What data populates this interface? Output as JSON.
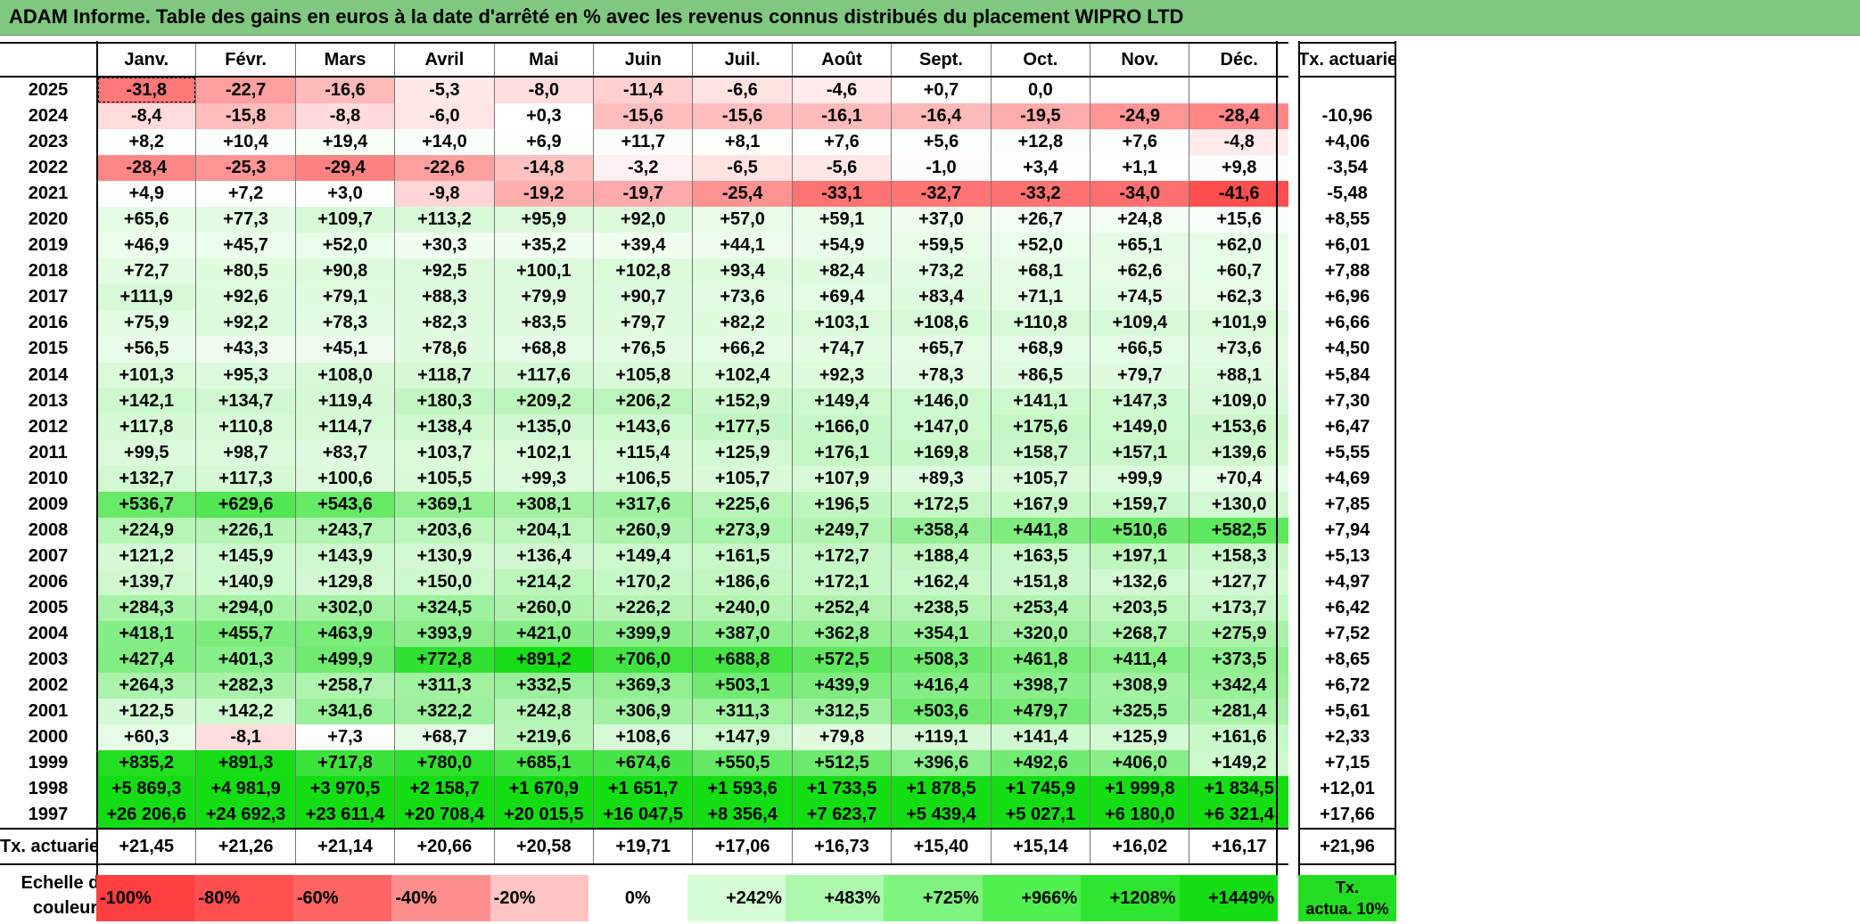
{
  "title": "ADAM Informe. Table des gains en euros à la date d'arrêté en % avec les revenus connus distribués du placement WIPRO LTD",
  "months": [
    "Janv.",
    "Févr.",
    "Mars",
    "Avril",
    "Mai",
    "Juin",
    "Juil.",
    "Août",
    "Sept.",
    "Oct.",
    "Nov.",
    "Déc."
  ],
  "side_header": "Tx. actuariel",
  "rows": [
    {
      "year": "2025",
      "values": [
        "-31,8",
        "-22,7",
        "-16,6",
        "-5,3",
        "-8,0",
        "-11,4",
        "-6,6",
        "-4,6",
        "+0,7",
        "0,0",
        "",
        ""
      ],
      "rate": ""
    },
    {
      "year": "2024",
      "values": [
        "-8,4",
        "-15,8",
        "-8,8",
        "-6,0",
        "+0,3",
        "-15,6",
        "-15,6",
        "-16,1",
        "-16,4",
        "-19,5",
        "-24,9",
        "-28,4"
      ],
      "rate": "-10,96"
    },
    {
      "year": "2023",
      "values": [
        "+8,2",
        "+10,4",
        "+19,4",
        "+14,0",
        "+6,9",
        "+11,7",
        "+8,1",
        "+7,6",
        "+5,6",
        "+12,8",
        "+7,6",
        "-4,8"
      ],
      "rate": "+4,06"
    },
    {
      "year": "2022",
      "values": [
        "-28,4",
        "-25,3",
        "-29,4",
        "-22,6",
        "-14,8",
        "-3,2",
        "-6,5",
        "-5,6",
        "-1,0",
        "+3,4",
        "+1,1",
        "+9,8"
      ],
      "rate": "-3,54"
    },
    {
      "year": "2021",
      "values": [
        "+4,9",
        "+7,2",
        "+3,0",
        "-9,8",
        "-19,2",
        "-19,7",
        "-25,4",
        "-33,1",
        "-32,7",
        "-33,2",
        "-34,0",
        "-41,6"
      ],
      "rate": "-5,48"
    },
    {
      "year": "2020",
      "values": [
        "+65,6",
        "+77,3",
        "+109,7",
        "+113,2",
        "+95,9",
        "+92,0",
        "+57,0",
        "+59,1",
        "+37,0",
        "+26,7",
        "+24,8",
        "+15,6"
      ],
      "rate": "+8,55"
    },
    {
      "year": "2019",
      "values": [
        "+46,9",
        "+45,7",
        "+52,0",
        "+30,3",
        "+35,2",
        "+39,4",
        "+44,1",
        "+54,9",
        "+59,5",
        "+52,0",
        "+65,1",
        "+62,0"
      ],
      "rate": "+6,01"
    },
    {
      "year": "2018",
      "values": [
        "+72,7",
        "+80,5",
        "+90,8",
        "+92,5",
        "+100,1",
        "+102,8",
        "+93,4",
        "+82,4",
        "+73,2",
        "+68,1",
        "+62,6",
        "+60,7"
      ],
      "rate": "+7,88"
    },
    {
      "year": "2017",
      "values": [
        "+111,9",
        "+92,6",
        "+79,1",
        "+88,3",
        "+79,9",
        "+90,7",
        "+73,6",
        "+69,4",
        "+83,4",
        "+71,1",
        "+74,5",
        "+62,3"
      ],
      "rate": "+6,96"
    },
    {
      "year": "2016",
      "values": [
        "+75,9",
        "+92,2",
        "+78,3",
        "+82,3",
        "+83,5",
        "+79,7",
        "+82,2",
        "+103,1",
        "+108,6",
        "+110,8",
        "+109,4",
        "+101,9"
      ],
      "rate": "+6,66"
    },
    {
      "year": "2015",
      "values": [
        "+56,5",
        "+43,3",
        "+45,1",
        "+78,6",
        "+68,8",
        "+76,5",
        "+66,2",
        "+74,7",
        "+65,7",
        "+68,9",
        "+66,5",
        "+73,6"
      ],
      "rate": "+4,50"
    },
    {
      "year": "2014",
      "values": [
        "+101,3",
        "+95,3",
        "+108,0",
        "+118,7",
        "+117,6",
        "+105,8",
        "+102,4",
        "+92,3",
        "+78,3",
        "+86,5",
        "+79,7",
        "+88,1"
      ],
      "rate": "+5,84"
    },
    {
      "year": "2013",
      "values": [
        "+142,1",
        "+134,7",
        "+119,4",
        "+180,3",
        "+209,2",
        "+206,2",
        "+152,9",
        "+149,4",
        "+146,0",
        "+141,1",
        "+147,3",
        "+109,0"
      ],
      "rate": "+7,30"
    },
    {
      "year": "2012",
      "values": [
        "+117,8",
        "+110,8",
        "+114,7",
        "+138,4",
        "+135,0",
        "+143,6",
        "+177,5",
        "+166,0",
        "+147,0",
        "+175,6",
        "+149,0",
        "+153,6"
      ],
      "rate": "+6,47"
    },
    {
      "year": "2011",
      "values": [
        "+99,5",
        "+98,7",
        "+83,7",
        "+103,7",
        "+102,1",
        "+115,4",
        "+125,9",
        "+176,1",
        "+169,8",
        "+158,7",
        "+157,1",
        "+139,6"
      ],
      "rate": "+5,55"
    },
    {
      "year": "2010",
      "values": [
        "+132,7",
        "+117,3",
        "+100,6",
        "+105,5",
        "+99,3",
        "+106,5",
        "+105,7",
        "+107,9",
        "+89,3",
        "+105,7",
        "+99,9",
        "+70,4"
      ],
      "rate": "+4,69"
    },
    {
      "year": "2009",
      "values": [
        "+536,7",
        "+629,6",
        "+543,6",
        "+369,1",
        "+308,1",
        "+317,6",
        "+225,6",
        "+196,5",
        "+172,5",
        "+167,9",
        "+159,7",
        "+130,0"
      ],
      "rate": "+7,85"
    },
    {
      "year": "2008",
      "values": [
        "+224,9",
        "+226,1",
        "+243,7",
        "+203,6",
        "+204,1",
        "+260,9",
        "+273,9",
        "+249,7",
        "+358,4",
        "+441,8",
        "+510,6",
        "+582,5"
      ],
      "rate": "+7,94"
    },
    {
      "year": "2007",
      "values": [
        "+121,2",
        "+145,9",
        "+143,9",
        "+130,9",
        "+136,4",
        "+149,4",
        "+161,5",
        "+172,7",
        "+188,4",
        "+163,5",
        "+197,1",
        "+158,3"
      ],
      "rate": "+5,13"
    },
    {
      "year": "2006",
      "values": [
        "+139,7",
        "+140,9",
        "+129,8",
        "+150,0",
        "+214,2",
        "+170,2",
        "+186,6",
        "+172,1",
        "+162,4",
        "+151,8",
        "+132,6",
        "+127,7"
      ],
      "rate": "+4,97"
    },
    {
      "year": "2005",
      "values": [
        "+284,3",
        "+294,0",
        "+302,0",
        "+324,5",
        "+260,0",
        "+226,2",
        "+240,0",
        "+252,4",
        "+238,5",
        "+253,4",
        "+203,5",
        "+173,7"
      ],
      "rate": "+6,42"
    },
    {
      "year": "2004",
      "values": [
        "+418,1",
        "+455,7",
        "+463,9",
        "+393,9",
        "+421,0",
        "+399,9",
        "+387,0",
        "+362,8",
        "+354,1",
        "+320,0",
        "+268,7",
        "+275,9"
      ],
      "rate": "+7,52"
    },
    {
      "year": "2003",
      "values": [
        "+427,4",
        "+401,3",
        "+499,9",
        "+772,8",
        "+891,2",
        "+706,0",
        "+688,8",
        "+572,5",
        "+508,3",
        "+461,8",
        "+411,4",
        "+373,5"
      ],
      "rate": "+8,65"
    },
    {
      "year": "2002",
      "values": [
        "+264,3",
        "+282,3",
        "+258,7",
        "+311,3",
        "+332,5",
        "+369,3",
        "+503,1",
        "+439,9",
        "+416,4",
        "+398,7",
        "+308,9",
        "+342,4"
      ],
      "rate": "+6,72"
    },
    {
      "year": "2001",
      "values": [
        "+122,5",
        "+142,2",
        "+341,6",
        "+322,2",
        "+242,8",
        "+306,9",
        "+311,3",
        "+312,5",
        "+503,6",
        "+479,7",
        "+325,5",
        "+281,4"
      ],
      "rate": "+5,61"
    },
    {
      "year": "2000",
      "values": [
        "+60,3",
        "-8,1",
        "+7,3",
        "+68,7",
        "+219,6",
        "+108,6",
        "+147,9",
        "+79,8",
        "+119,1",
        "+141,4",
        "+125,9",
        "+161,6"
      ],
      "rate": "+2,33"
    },
    {
      "year": "1999",
      "values": [
        "+835,2",
        "+891,3",
        "+717,8",
        "+780,0",
        "+685,1",
        "+674,6",
        "+550,5",
        "+512,5",
        "+396,6",
        "+492,6",
        "+406,0",
        "+149,2"
      ],
      "rate": "+7,15"
    },
    {
      "year": "1998",
      "values": [
        "+5 869,3",
        "+4 981,9",
        "+3 970,5",
        "+2 158,7",
        "+1 670,9",
        "+1 651,7",
        "+1 593,6",
        "+1 733,5",
        "+1 878,5",
        "+1 745,9",
        "+1 999,8",
        "+1 834,5"
      ],
      "rate": "+12,01"
    },
    {
      "year": "1997",
      "values": [
        "+26 206,6",
        "+24 692,3",
        "+23 611,4",
        "+20 708,4",
        "+20 015,5",
        "+16 047,5",
        "+8 356,4",
        "+7 623,7",
        "+5 439,4",
        "+5 027,1",
        "+6 180,0",
        "+6 321,4"
      ],
      "rate": "+17,66"
    }
  ],
  "footer": {
    "label": "Tx. actuariel",
    "values": [
      "+21,45",
      "+21,26",
      "+21,14",
      "+20,66",
      "+20,58",
      "+19,71",
      "+17,06",
      "+16,73",
      "+15,40",
      "+15,14",
      "+16,02",
      "+16,17"
    ],
    "total": "+21,96"
  },
  "legend": {
    "label_line1": "Echelle de",
    "label_line2": "couleur",
    "items": [
      {
        "text": "-100%",
        "color": "#ff4040",
        "align": "left"
      },
      {
        "text": "-80%",
        "color": "#ff4f4f",
        "align": "left"
      },
      {
        "text": "-60%",
        "color": "#ff6565",
        "align": "left"
      },
      {
        "text": "-40%",
        "color": "#ff8f8f",
        "align": "left"
      },
      {
        "text": "-20%",
        "color": "#ffc4c4",
        "align": "left"
      },
      {
        "text": "0%",
        "color": "#ffffff",
        "align": "center"
      },
      {
        "text": "+242%",
        "color": "#d5fcd5",
        "align": "right"
      },
      {
        "text": "+483%",
        "color": "#aef8ae",
        "align": "right"
      },
      {
        "text": "+725%",
        "color": "#7ef37e",
        "align": "right"
      },
      {
        "text": "+966%",
        "color": "#4ff04f",
        "align": "right"
      },
      {
        "text": "+1208%",
        "color": "#2ee62e",
        "align": "right"
      },
      {
        "text": "+1449%",
        "color": "#14dd14",
        "align": "right"
      }
    ],
    "actua_line1": "Tx.",
    "actua_line2": "actua. 10%"
  },
  "colors": {
    "title_bg": "#80c880",
    "red_max": "#ff4040",
    "green_max": "#14dd14",
    "neutral": "#ffffff"
  }
}
